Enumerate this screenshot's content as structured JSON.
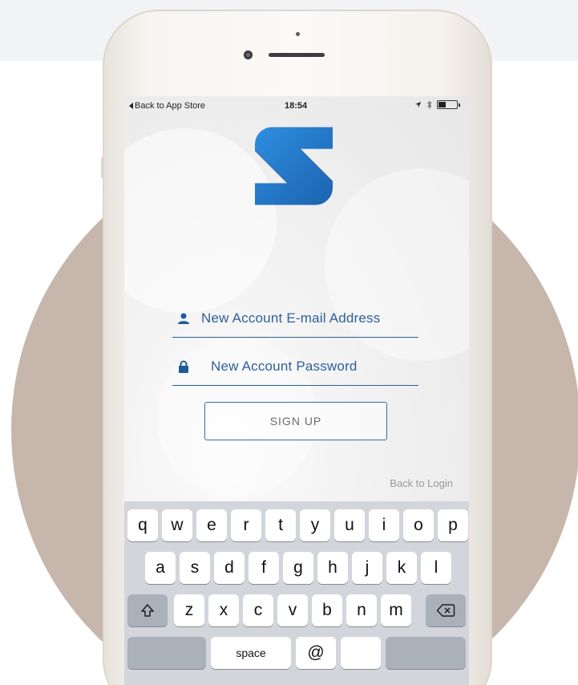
{
  "status_bar": {
    "back_label": "Back to App Store",
    "time": "18:54"
  },
  "form": {
    "email_placeholder": "New Account E-mail Address",
    "password_placeholder": "New Account Password",
    "signup_label": "SIGN UP",
    "back_to_login": "Back to Login"
  },
  "keyboard": {
    "row1": [
      "q",
      "w",
      "e",
      "r",
      "t",
      "y",
      "u",
      "i",
      "o",
      "p"
    ],
    "row2": [
      "a",
      "s",
      "d",
      "f",
      "g",
      "h",
      "j",
      "k",
      "l"
    ],
    "row3": [
      "z",
      "x",
      "c",
      "v",
      "b",
      "n",
      "m"
    ],
    "space_label": "space",
    "at_label": "@",
    "shift_icon": "shift-icon",
    "delete_icon": "backspace-icon"
  },
  "colors": {
    "brand_blue": "#2f5f9a",
    "logo_blue": "#1e73c2",
    "backdrop_circle": "#c6b6ab"
  }
}
